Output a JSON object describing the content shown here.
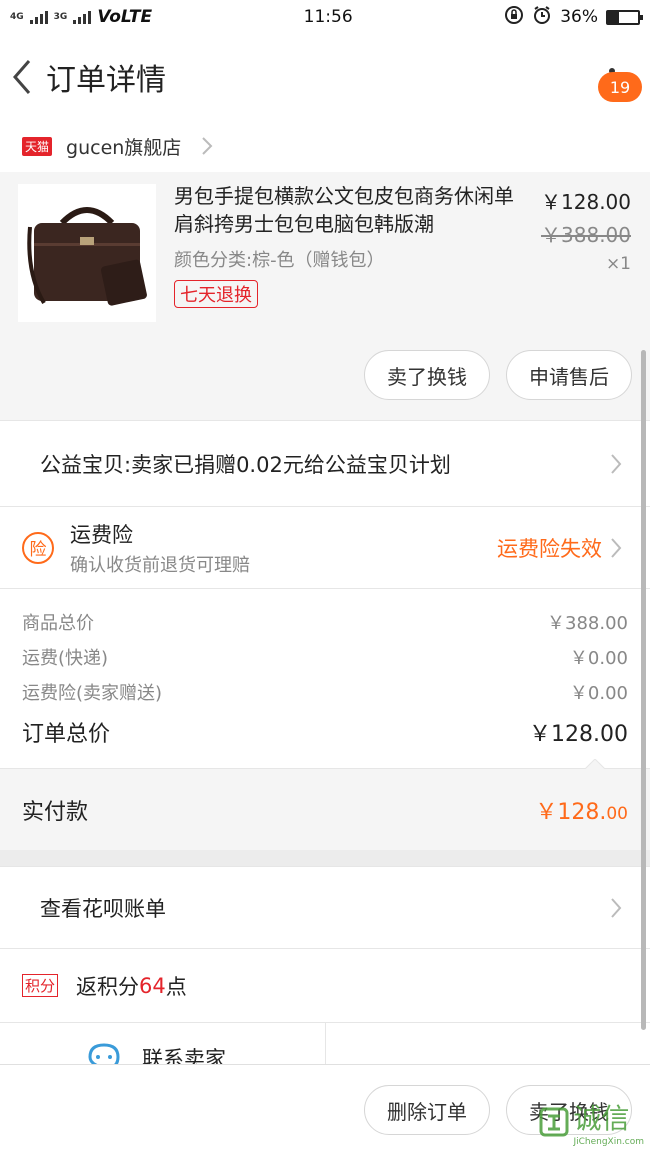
{
  "status_bar": {
    "network": "4G",
    "network2": "3G",
    "volte": "VoLTE",
    "time": "11:56",
    "battery": "36%",
    "battery_level": 0.36
  },
  "nav": {
    "title": "订单详情",
    "notification_count": "19"
  },
  "shop": {
    "badge": "天猫",
    "name": "gucen旗舰店"
  },
  "product": {
    "title": "男包手提包横款公文包皮包商务休闲单肩斜挎男士包包电脑包韩版潮",
    "variant": "颜色分类:棕-色（赠钱包）",
    "tag": "七天退换",
    "price": "￥128.00",
    "original_price": "￥388.00",
    "quantity": "×1",
    "buttons": {
      "sell": "卖了换钱",
      "after_sale": "申请售后"
    }
  },
  "charity": {
    "text": "公益宝贝:卖家已捐赠0.02元给公益宝贝计划"
  },
  "insurance": {
    "icon_text": "险",
    "title": "运费险",
    "subtitle": "确认收货前退货可理赔",
    "status": "运费险失效",
    "status_color": "#ff6a1a"
  },
  "summary": {
    "items": [
      {
        "label": "商品总价",
        "value": "￥388.00"
      },
      {
        "label": "运费(快递)",
        "value": "￥0.00"
      },
      {
        "label": "运费险(卖家赠送)",
        "value": "￥0.00"
      }
    ],
    "total_label": "订单总价",
    "total_value": "￥128.00",
    "paid_label": "实付款",
    "paid_value_main": "￥128.",
    "paid_value_cents": "00"
  },
  "huabei": {
    "text": "查看花呗账单"
  },
  "points": {
    "badge": "积分",
    "prefix": "返积分",
    "number": "64",
    "suffix": "点"
  },
  "contact": {
    "seller": "联系卖家",
    "phone": ""
  },
  "bottom_bar": {
    "delete": "删除订单",
    "sell": "卖了换钱"
  },
  "watermark": {
    "text": "诚信",
    "url": "JiChengXin.com"
  },
  "colors": {
    "accent": "#ff6a1a",
    "tmall_red": "#e4242b"
  }
}
